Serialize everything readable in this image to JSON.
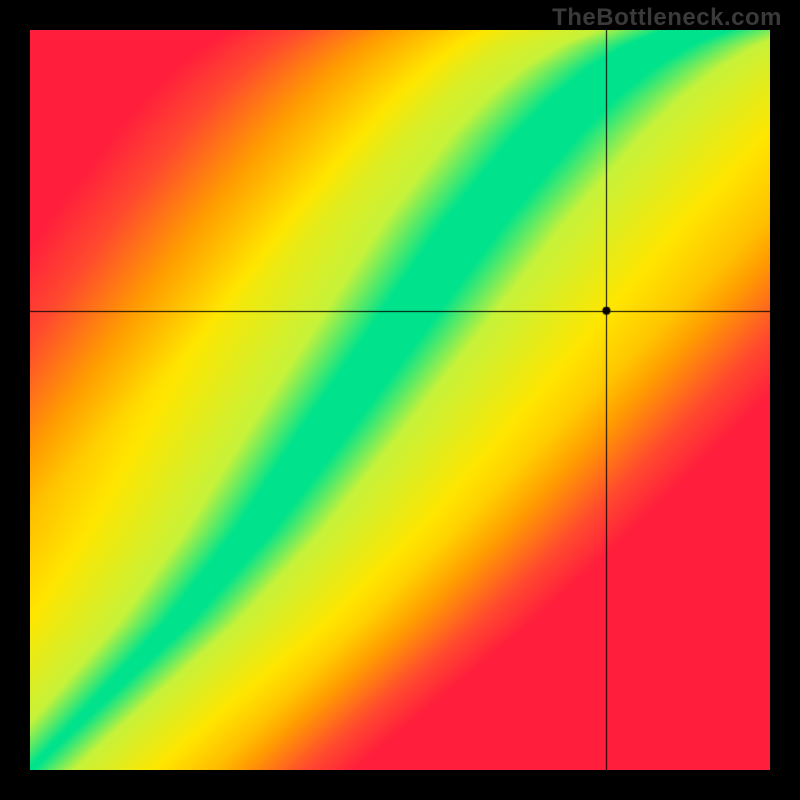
{
  "watermark": "TheBottleneck.com",
  "chart_data": {
    "type": "heatmap",
    "title": "",
    "xlabel": "",
    "ylabel": "",
    "xlim": [
      0,
      1
    ],
    "ylim": [
      0,
      1
    ],
    "grid": false,
    "legend_position": "none",
    "crosshair": {
      "x": 0.78,
      "y": 0.62
    },
    "marker": {
      "x": 0.78,
      "y": 0.62
    },
    "ridge": {
      "description": "Green zero-mismatch ridge sampled as (x, y) points across the unit square; width is the visual band half-width at each x.",
      "points": [
        {
          "x": 0.0,
          "y": 0.0,
          "width": 0.004
        },
        {
          "x": 0.05,
          "y": 0.05,
          "width": 0.006
        },
        {
          "x": 0.1,
          "y": 0.1,
          "width": 0.01
        },
        {
          "x": 0.15,
          "y": 0.15,
          "width": 0.014
        },
        {
          "x": 0.2,
          "y": 0.2,
          "width": 0.018
        },
        {
          "x": 0.25,
          "y": 0.26,
          "width": 0.022
        },
        {
          "x": 0.3,
          "y": 0.32,
          "width": 0.026
        },
        {
          "x": 0.35,
          "y": 0.39,
          "width": 0.03
        },
        {
          "x": 0.4,
          "y": 0.46,
          "width": 0.034
        },
        {
          "x": 0.45,
          "y": 0.53,
          "width": 0.036
        },
        {
          "x": 0.5,
          "y": 0.6,
          "width": 0.038
        },
        {
          "x": 0.55,
          "y": 0.67,
          "width": 0.04
        },
        {
          "x": 0.6,
          "y": 0.74,
          "width": 0.042
        },
        {
          "x": 0.65,
          "y": 0.8,
          "width": 0.043
        },
        {
          "x": 0.7,
          "y": 0.86,
          "width": 0.044
        },
        {
          "x": 0.75,
          "y": 0.91,
          "width": 0.044
        },
        {
          "x": 0.8,
          "y": 0.95,
          "width": 0.044
        },
        {
          "x": 0.85,
          "y": 0.98,
          "width": 0.044
        },
        {
          "x": 0.9,
          "y": 1.0,
          "width": 0.044
        }
      ]
    },
    "color_stops": {
      "description": "Color ramp keyed by absolute mismatch (0 = on ridge, 1 = far from ridge).",
      "stops": [
        {
          "t": 0.0,
          "color": "#00E38C"
        },
        {
          "t": 0.1,
          "color": "#C6F23A"
        },
        {
          "t": 0.3,
          "color": "#FFE600"
        },
        {
          "t": 0.55,
          "color": "#FF9E00"
        },
        {
          "t": 0.8,
          "color": "#FF4A2E"
        },
        {
          "t": 1.0,
          "color": "#FF1E3C"
        }
      ]
    }
  }
}
